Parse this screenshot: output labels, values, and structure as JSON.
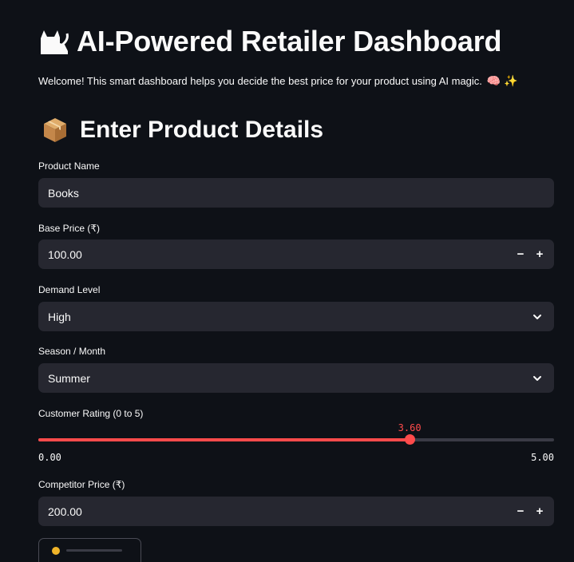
{
  "header": {
    "title_icon": "cat-silhouette-icon",
    "title": "AI-Powered Retailer Dashboard",
    "welcome": "Welcome! This smart dashboard helps you decide the best price for your product using AI magic.",
    "welcome_emojis": "🧠 ✨"
  },
  "section": {
    "icon": "package-box-icon",
    "title": "Enter Product Details"
  },
  "fields": {
    "product_name": {
      "label": "Product Name",
      "value": "Books"
    },
    "base_price": {
      "label": "Base Price (₹)",
      "value": "100.00",
      "minus": "−",
      "plus": "+"
    },
    "demand_level": {
      "label": "Demand Level",
      "value": "High"
    },
    "season": {
      "label": "Season / Month",
      "value": "Summer"
    },
    "customer_rating": {
      "label": "Customer Rating (0 to 5)",
      "value": 3.6,
      "value_text": "3.60",
      "min_text": "0.00",
      "max_text": "5.00",
      "min": 0,
      "max": 5
    },
    "competitor_price": {
      "label": "Competitor Price (₹)",
      "value": "200.00",
      "minus": "−",
      "plus": "+"
    }
  },
  "colors": {
    "background": "#0e1117",
    "input_bg": "#262730",
    "accent": "#ff4b4b",
    "text": "#fafafa"
  }
}
